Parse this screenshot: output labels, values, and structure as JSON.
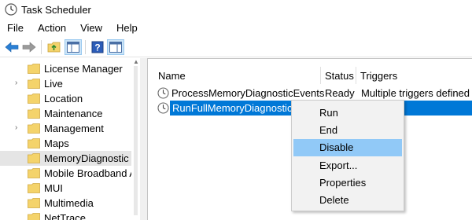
{
  "window": {
    "title": "Task Scheduler"
  },
  "menubar": {
    "items": [
      "File",
      "Action",
      "View",
      "Help"
    ]
  },
  "toolbar": {
    "icons": [
      "back-arrow-icon",
      "forward-arrow-icon",
      "folder-up-icon",
      "show-hide-console-tree-icon",
      "help-icon",
      "show-hide-action-pane-icon"
    ]
  },
  "tree": {
    "items": [
      {
        "label": "License Manager",
        "expandable": false,
        "selected": false
      },
      {
        "label": "Live",
        "expandable": true,
        "selected": false
      },
      {
        "label": "Location",
        "expandable": false,
        "selected": false
      },
      {
        "label": "Maintenance",
        "expandable": false,
        "selected": false
      },
      {
        "label": "Management",
        "expandable": true,
        "selected": false
      },
      {
        "label": "Maps",
        "expandable": false,
        "selected": false
      },
      {
        "label": "MemoryDiagnostic",
        "expandable": false,
        "selected": true
      },
      {
        "label": "Mobile Broadband A",
        "expandable": false,
        "selected": false
      },
      {
        "label": "MUI",
        "expandable": false,
        "selected": false
      },
      {
        "label": "Multimedia",
        "expandable": false,
        "selected": false
      },
      {
        "label": "NetTrace",
        "expandable": false,
        "selected": false
      }
    ]
  },
  "tasks": {
    "columns": [
      "Name",
      "Status",
      "Triggers"
    ],
    "rows": [
      {
        "name": "ProcessMemoryDiagnosticEvents",
        "status": "Ready",
        "triggers": "Multiple triggers defined",
        "selected": false
      },
      {
        "name": "RunFullMemoryDiagnostic",
        "status": "",
        "triggers": "",
        "selected": true
      }
    ]
  },
  "context_menu": {
    "items": [
      "Run",
      "End",
      "Disable",
      "Export...",
      "Properties",
      "Delete"
    ],
    "highlighted": "Disable"
  },
  "colors": {
    "selection_blue": "#0078d7",
    "menu_hover": "#91c9f7",
    "menu_bg": "#f2f2f2",
    "tree_selected": "#e5e5e5",
    "folder_yellow": "#f4d36b"
  }
}
